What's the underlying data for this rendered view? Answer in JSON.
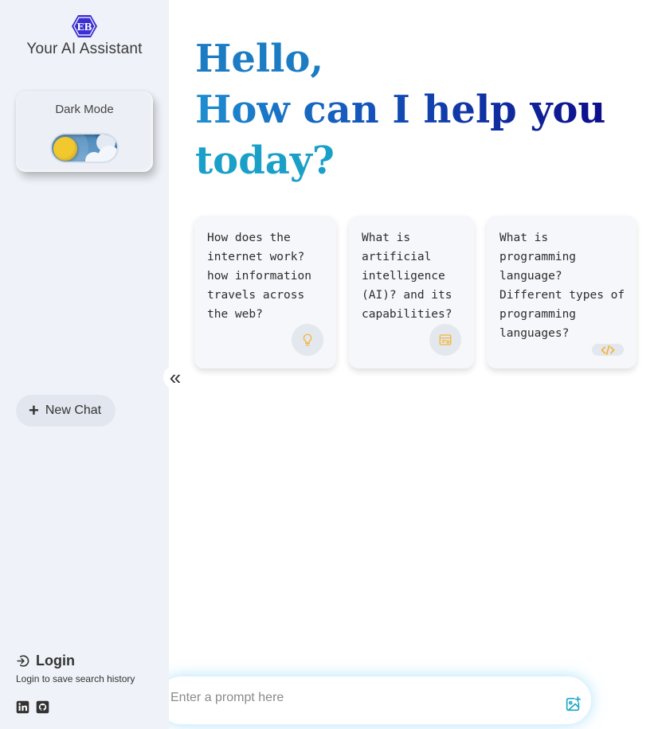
{
  "sidebar": {
    "logo_text": "EB",
    "app_title": "Your AI Assistant",
    "dark_mode_label": "Dark Mode",
    "dark_mode_on": false,
    "new_chat_label": "New Chat",
    "login_label": "Login",
    "login_subtext": "Login to save search history",
    "socials": [
      "linkedin-icon",
      "github-icon"
    ]
  },
  "collapse": {
    "glyph": "«"
  },
  "greeting": {
    "line1": "Hello,",
    "line2": "How can I help you",
    "line3": "today?"
  },
  "suggestions": [
    {
      "text": "How does the internet work? how information travels across the web?",
      "icon": "lightbulb-icon"
    },
    {
      "text": "What is artificial intelligence (AI)? and its capabilities?",
      "icon": "browser-window-icon"
    },
    {
      "text": "What is programming language? Different types of programming languages?",
      "icon": "code-icon"
    }
  ],
  "prompt": {
    "placeholder": "Enter a prompt here",
    "value": ""
  },
  "colors": {
    "accent": "#1b7cc4",
    "icon_yellow": "#f3b63a",
    "image_icon": "#1aa6c8",
    "logo_purple": "#3a2fd1"
  }
}
